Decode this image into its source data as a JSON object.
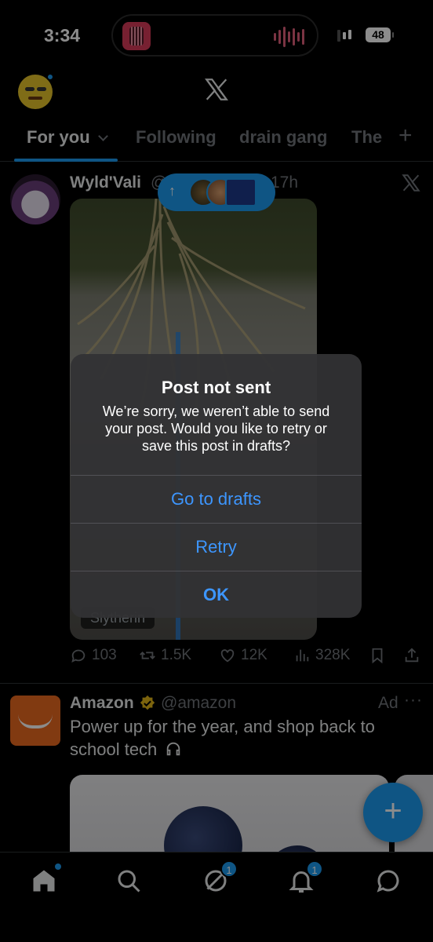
{
  "status_bar": {
    "time": "3:34",
    "battery": "48"
  },
  "tabs": [
    {
      "label": "For you",
      "active": true
    },
    {
      "label": "Following",
      "active": false
    },
    {
      "label": "drain gang",
      "active": false
    },
    {
      "label": "The",
      "active": false
    }
  ],
  "tab_add_label": "+",
  "post": {
    "author": "Wyld'Vali",
    "handle": "@",
    "time": "17h",
    "image_alt_badge": "Slytherin",
    "actions": {
      "replies": "103",
      "reposts": "1.5K",
      "likes": "12K",
      "views": "328K"
    }
  },
  "new_posts_pill": {
    "arrow": "↑"
  },
  "ad": {
    "author": "Amazon",
    "handle": "@amazon",
    "tag": "Ad",
    "more": "···",
    "text": "Power up for the year, and shop back to school tech"
  },
  "compose_fab": "+",
  "bottom_nav": {
    "grok_badge": "1",
    "notifications_badge": "1"
  },
  "alert": {
    "title": "Post not sent",
    "message": "We’re sorry, we weren’t able to send your post. Would you like to retry or save this post in drafts?",
    "buttons": [
      "Go to drafts",
      "Retry",
      "OK"
    ]
  },
  "colors": {
    "accent": "#1d9bf0",
    "alert_button": "#3d96ff",
    "secondary_text": "#71767b",
    "amazon_orange": "#ec6a1f"
  }
}
